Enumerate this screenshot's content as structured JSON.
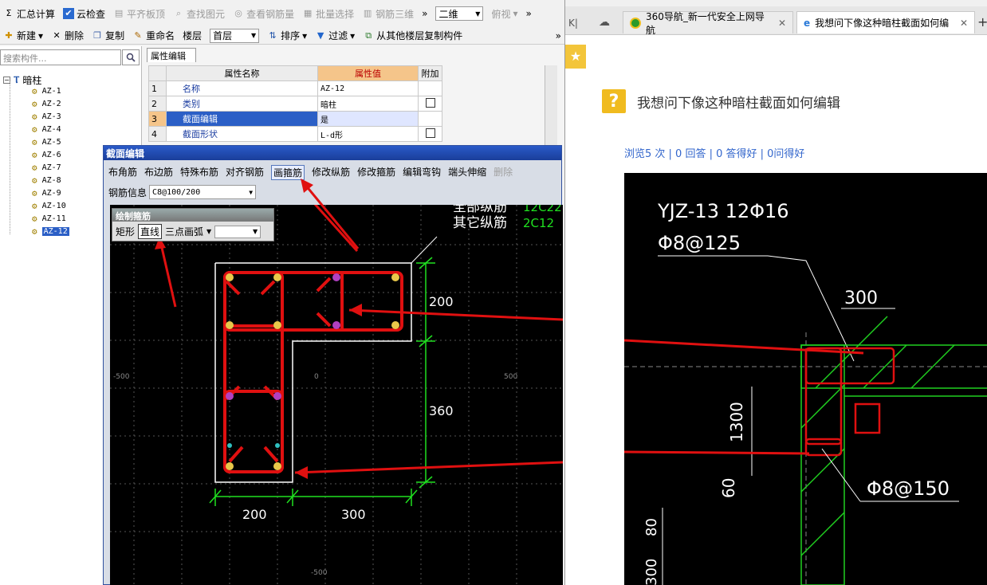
{
  "left_toolbar1": {
    "items": [
      {
        "label": "汇总计算",
        "icon": "sum-icon",
        "enabled": true
      },
      {
        "label": "云检查",
        "icon": "cloud-check-icon",
        "enabled": true
      },
      {
        "label": "平齐板顶",
        "icon": "align-top-icon",
        "enabled": false
      },
      {
        "label": "查找图元",
        "icon": "find-icon",
        "enabled": false
      },
      {
        "label": "查看钢筋量",
        "icon": "view-rebar-icon",
        "enabled": false
      },
      {
        "label": "批量选择",
        "icon": "batch-select-icon",
        "enabled": false
      },
      {
        "label": "钢筋三维",
        "icon": "rebar-3d-icon",
        "enabled": false
      }
    ],
    "more": "»",
    "view_mode": "二维",
    "view_angle": "俯视",
    "more2": "»"
  },
  "left_toolbar2": {
    "new_label": "新建",
    "delete_label": "删除",
    "copy_label": "复制",
    "rename_label": "重命名",
    "floor_label": "楼层",
    "floor_value": "首层",
    "sort_label": "排序",
    "filter_label": "过滤",
    "copy_from_floor_label": "从其他楼层复制构件",
    "more": "»"
  },
  "tree": {
    "search_placeholder": "搜索构件...",
    "root_label": "暗柱",
    "items": [
      "AZ-1",
      "AZ-2",
      "AZ-3",
      "AZ-4",
      "AZ-5",
      "AZ-6",
      "AZ-7",
      "AZ-8",
      "AZ-9",
      "AZ-10",
      "AZ-11",
      "AZ-12"
    ],
    "selected": "AZ-12"
  },
  "properties": {
    "tab_label": "属性编辑",
    "columns": [
      "属性名称",
      "属性值",
      "附加"
    ],
    "rows": [
      {
        "num": "1",
        "name": "名称",
        "value": "AZ-12",
        "extra": false
      },
      {
        "num": "2",
        "name": "类别",
        "value": "暗柱",
        "extra": true
      },
      {
        "num": "3",
        "name": "截面编辑",
        "value": "是",
        "extra": false
      },
      {
        "num": "4",
        "name": "截面形状",
        "value": "L-d形",
        "extra": true
      }
    ]
  },
  "dialog": {
    "title": "截面编辑",
    "tools": [
      {
        "label": "布角筋",
        "active": false,
        "enabled": true
      },
      {
        "label": "布边筋",
        "active": false,
        "enabled": true
      },
      {
        "label": "特殊布筋",
        "active": false,
        "enabled": true
      },
      {
        "label": "对齐钢筋",
        "active": false,
        "enabled": true
      },
      {
        "label": "画箍筋",
        "active": true,
        "enabled": true
      },
      {
        "label": "修改纵筋",
        "active": false,
        "enabled": true
      },
      {
        "label": "修改箍筋",
        "active": false,
        "enabled": true
      },
      {
        "label": "编辑弯钩",
        "active": false,
        "enabled": true
      },
      {
        "label": "端头伸缩",
        "active": false,
        "enabled": true
      },
      {
        "label": "删除",
        "active": false,
        "enabled": false
      }
    ],
    "rebar_info_label": "钢筋信息",
    "rebar_info_value": "C8@100/200",
    "draw_panel": {
      "title": "绘制箍筋",
      "options": [
        {
          "label": "矩形",
          "active": false
        },
        {
          "label": "直线",
          "active": true
        },
        {
          "label": "三点画弧",
          "active": false
        }
      ]
    },
    "canvas": {
      "label_all": "全部纵筋",
      "label_all_value": "12C22",
      "label_other": "其它纵筋",
      "label_other_value": "2C12",
      "dim_200_top": "200",
      "dim_360": "360",
      "dim_200_bottom": "200",
      "dim_300": "300",
      "axis_neg500": "-500",
      "axis_0": "0",
      "axis_500": "500",
      "axis_neg500_y": "-500"
    }
  },
  "browser": {
    "tabs": [
      {
        "label": "360导航_新一代安全上网导航",
        "active": false
      },
      {
        "label": "我想问下像这种暗柱截面如何编",
        "active": true
      }
    ],
    "question_title": "我想问下像这种暗柱截面如何编辑",
    "stats": "浏览5 次 | 0 回答 | 0 答得好 | 0问得好",
    "cad": {
      "label1": "YJZ-13  12Φ16",
      "label2": "Φ8@125",
      "dim_300": "300",
      "dim_1300": "1300",
      "dim_60": "60",
      "label3": "Φ8@150",
      "dim_80": "80",
      "dim_300b": "300"
    }
  }
}
